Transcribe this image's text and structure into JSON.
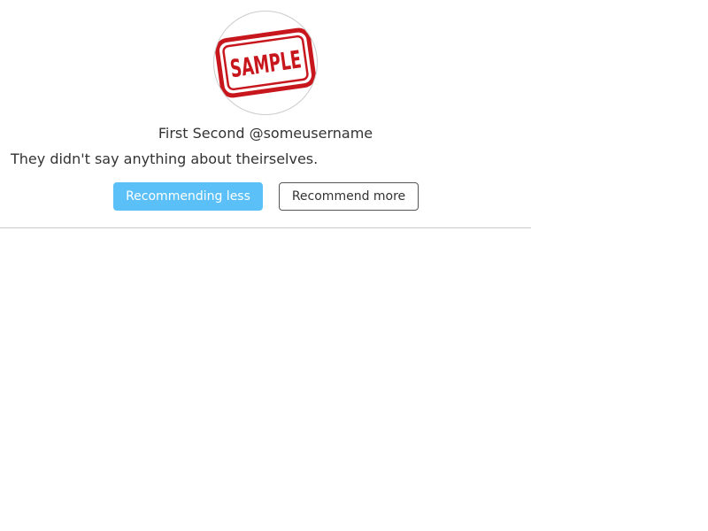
{
  "profile": {
    "avatar": {
      "stamp_text": "SAMPLE",
      "stamp_color": "#c8161d"
    },
    "display_name": "First Second",
    "username": "@someusername",
    "bio": "They didn't say anything about theirselves."
  },
  "actions": {
    "recommend_less_label": "Recommending less",
    "recommend_less_active": true,
    "recommend_more_label": "Recommend more"
  },
  "colors": {
    "active_button": "#5bc0f8",
    "divider": "#cccccc",
    "text": "#333333"
  }
}
